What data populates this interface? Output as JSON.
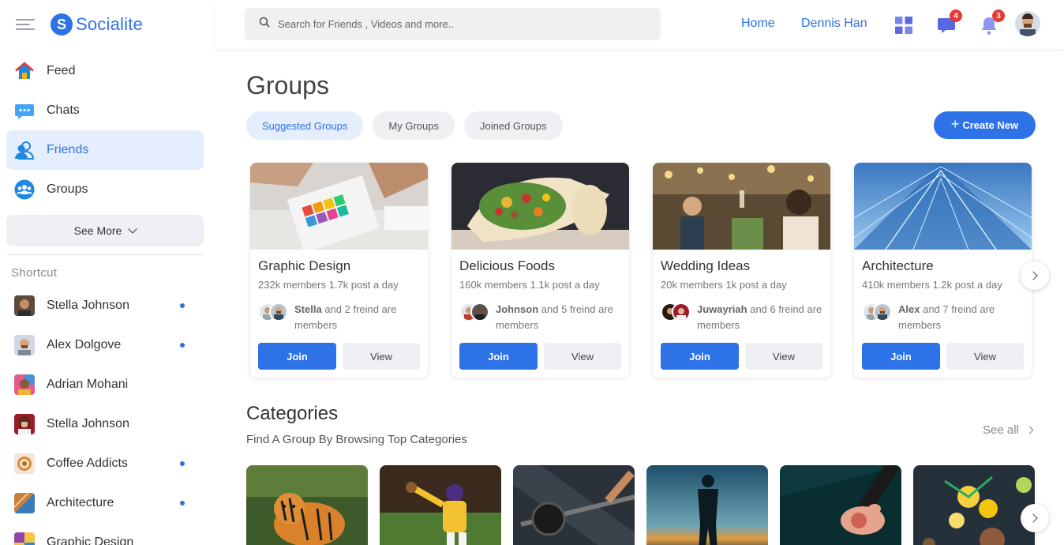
{
  "brand": {
    "name": "Socialite",
    "letter": "S"
  },
  "header": {
    "search_placeholder": "Search for Friends , Videos and more..",
    "links": [
      "Home",
      "Dennis Han"
    ],
    "messages_badge": "4",
    "notifications_badge": "3"
  },
  "sidebar": {
    "nav": [
      {
        "label": "Feed",
        "icon": "home-icon"
      },
      {
        "label": "Chats",
        "icon": "chat-icon"
      },
      {
        "label": "Friends",
        "icon": "friends-icon"
      },
      {
        "label": "Groups",
        "icon": "groups-icon"
      }
    ],
    "see_more": "See More",
    "shortcut_title": "Shortcut",
    "shortcuts": [
      {
        "label": "Stella Johnson",
        "online": true
      },
      {
        "label": "Alex Dolgove",
        "online": true
      },
      {
        "label": "Adrian Mohani",
        "online": false
      },
      {
        "label": "Stella Johnson",
        "online": false
      },
      {
        "label": "Coffee Addicts",
        "online": true
      },
      {
        "label": "Architecture",
        "online": true
      },
      {
        "label": "Graphic Design",
        "online": false
      }
    ]
  },
  "main": {
    "title": "Groups",
    "tabs": [
      "Suggested Groups",
      "My Groups",
      "Joined Groups"
    ],
    "create_label": "Create New",
    "groups": [
      {
        "title": "Graphic Design",
        "stats": "232k members 1.7k post a day",
        "friend": "Stella",
        "friends_text": "and 2 freind are members",
        "join": "Join",
        "view": "View"
      },
      {
        "title": "Delicious Foods",
        "stats": "160k members 1.1k post a day",
        "friend": "Johnson",
        "friends_text": "and 5 freind are members",
        "join": "Join",
        "view": "View"
      },
      {
        "title": "Wedding Ideas",
        "stats": "20k members 1k post a day",
        "friend": "Juwayriah",
        "friends_text": "and 6 freind are members",
        "join": "Join",
        "view": "View"
      },
      {
        "title": "Architecture",
        "stats": "410k members 1.2k post a day",
        "friend": "Alex",
        "friends_text": "and 7 freind are members",
        "join": "Join",
        "view": "View"
      }
    ],
    "categories_title": "Categories",
    "categories_subtitle": "Find A Group By Browsing Top Categories",
    "see_all": "See all"
  },
  "colors": {
    "accent": "#2e72e8",
    "badge": "#e53935"
  }
}
